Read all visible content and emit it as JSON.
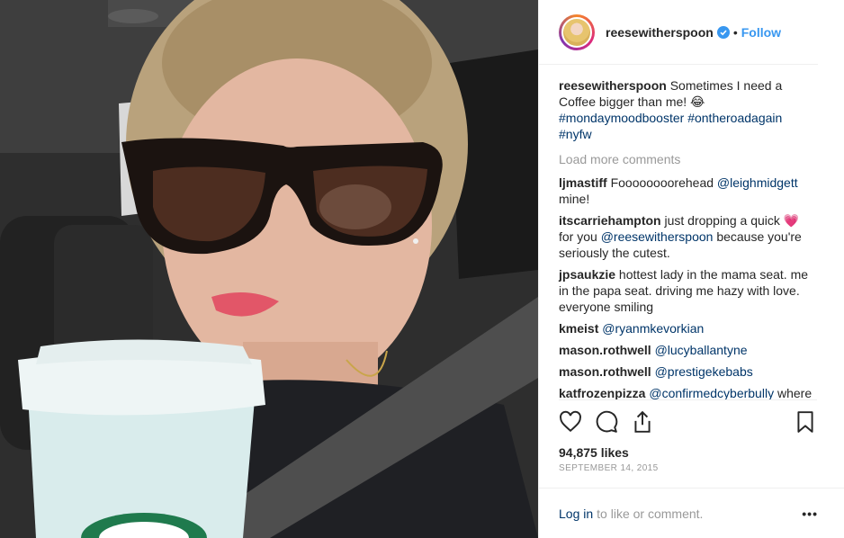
{
  "post": {
    "author": {
      "username": "reesewitherspoon",
      "verified_icon": "verified-badge-icon",
      "separator": "•",
      "follow_label": "Follow"
    },
    "caption": {
      "username": "reesewitherspoon",
      "text": "Sometimes I need a Coffee bigger than me! 😂",
      "hashtags": "#mondaymoodbooster #ontheroadagain #nyfw"
    },
    "load_more_label": "Load more comments",
    "comments": [
      {
        "user": "ljmastiff",
        "text": "Foooooooorehead",
        "mention": "@leighmidgett",
        "after": " mine!"
      },
      {
        "user": "itscarriehampton",
        "text": "just dropping a quick 💗 for you",
        "mention": "@reesewitherspoon",
        "after": " because you're seriously the cutest."
      },
      {
        "user": "jpsaukzie",
        "text": "hottest lady in the mama seat. me in the papa seat. driving me hazy with love. everyone smiling",
        "mention": "",
        "after": ""
      },
      {
        "user": "kmeist",
        "text": "",
        "mention": "@ryanmkevorkian",
        "after": ""
      },
      {
        "user": "mason.rothwell",
        "text": "",
        "mention": "@lucyballantyne",
        "after": ""
      },
      {
        "user": "mason.rothwell",
        "text": "",
        "mention": "@prestigekebabs",
        "after": ""
      },
      {
        "user": "katfrozenpizza",
        "text": "",
        "mention": "@confirmedcyberbully",
        "after": " where is her keepcup tho"
      }
    ],
    "likes": "94,875 likes",
    "date": "September 14, 2015",
    "footer": {
      "login_label": "Log in",
      "prompt": "to like or comment.",
      "more_label": "•••"
    },
    "icons": [
      "heart-icon",
      "comment-icon",
      "share-icon",
      "bookmark-icon"
    ],
    "colors": {
      "accent": "#3897f0",
      "link": "#003569",
      "muted": "#999999",
      "text": "#262626"
    }
  }
}
